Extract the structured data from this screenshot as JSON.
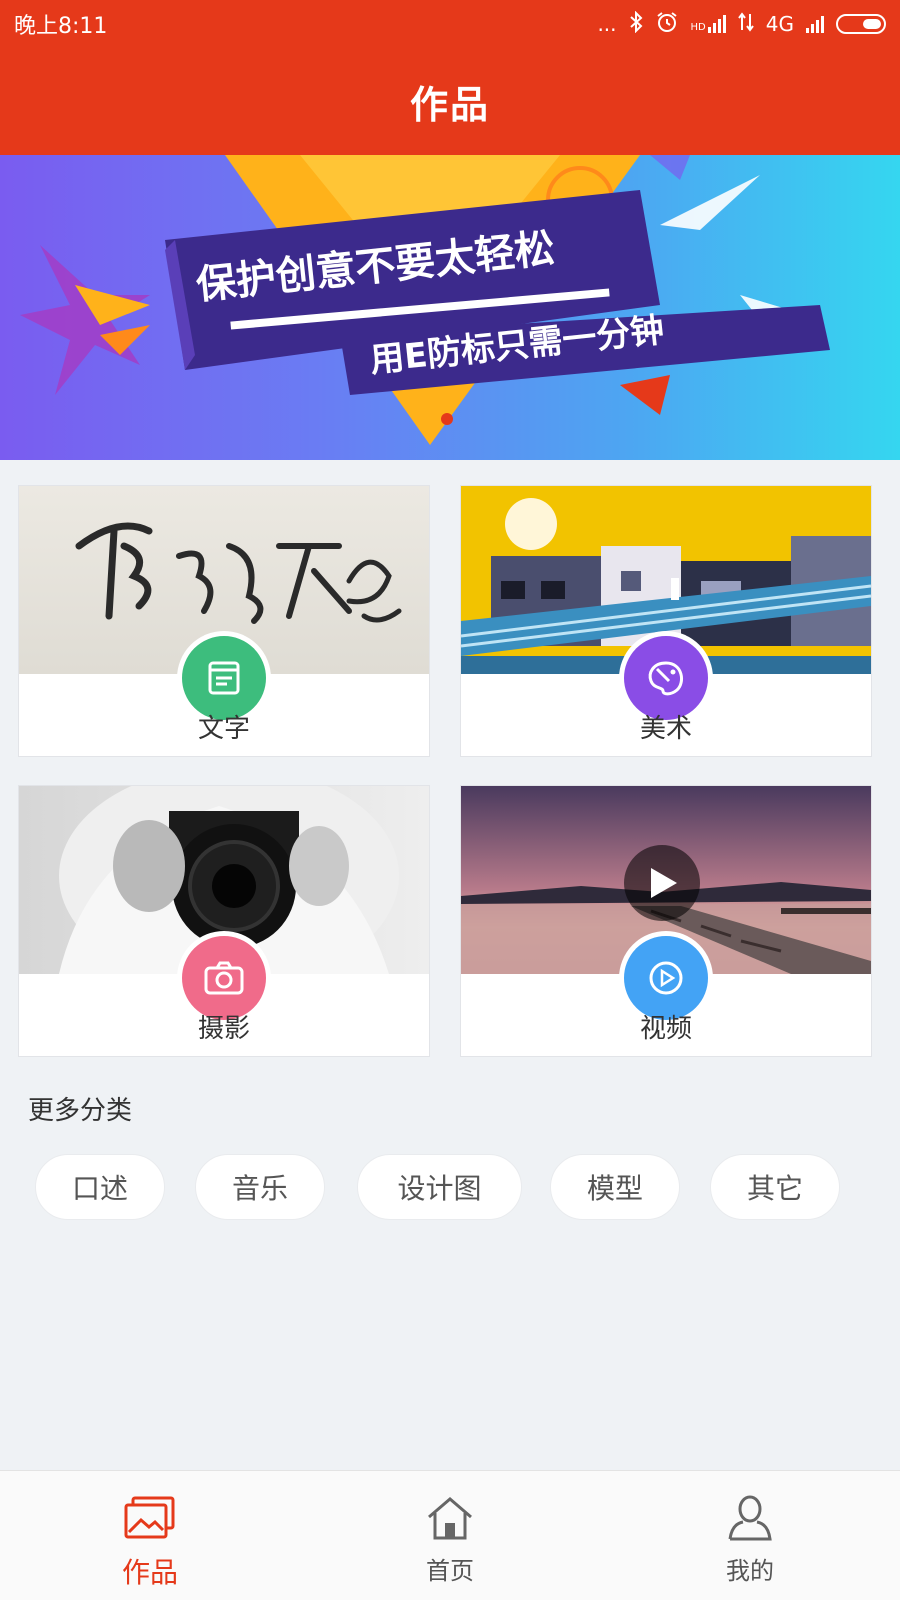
{
  "status_bar": {
    "time": "晚上8:11",
    "dots": "...",
    "bluetooth": "bluetooth-icon",
    "alarm": "alarm-icon",
    "hd_label": "HD",
    "network": "4G",
    "battery": "battery-icon"
  },
  "header": {
    "title": "作品"
  },
  "banner": {
    "headline": "保护创意不要太轻松",
    "subline": "用E防标只需一分钟",
    "pager_dot_color": "#e5391a"
  },
  "categories": [
    {
      "label": "文字",
      "icon": "document-icon",
      "badge_color": "#3dbd7d"
    },
    {
      "label": "美术",
      "icon": "palette-icon",
      "badge_color": "#8a4de6"
    },
    {
      "label": "摄影",
      "icon": "camera-icon",
      "badge_color": "#f06b8a"
    },
    {
      "label": "视频",
      "icon": "play-circle-icon",
      "badge_color": "#43a3f5"
    }
  ],
  "more": {
    "title": "更多分类",
    "chips": [
      "口述",
      "音乐",
      "设计图",
      "模型",
      "其它"
    ]
  },
  "tabbar": {
    "tabs": [
      {
        "label": "作品",
        "icon": "gallery-icon",
        "active": true
      },
      {
        "label": "首页",
        "icon": "home-icon",
        "active": false
      },
      {
        "label": "我的",
        "icon": "user-icon",
        "active": false
      }
    ],
    "active_color": "#e5391a"
  },
  "colors": {
    "primary": "#e5391a",
    "background": "#eff2f5"
  }
}
